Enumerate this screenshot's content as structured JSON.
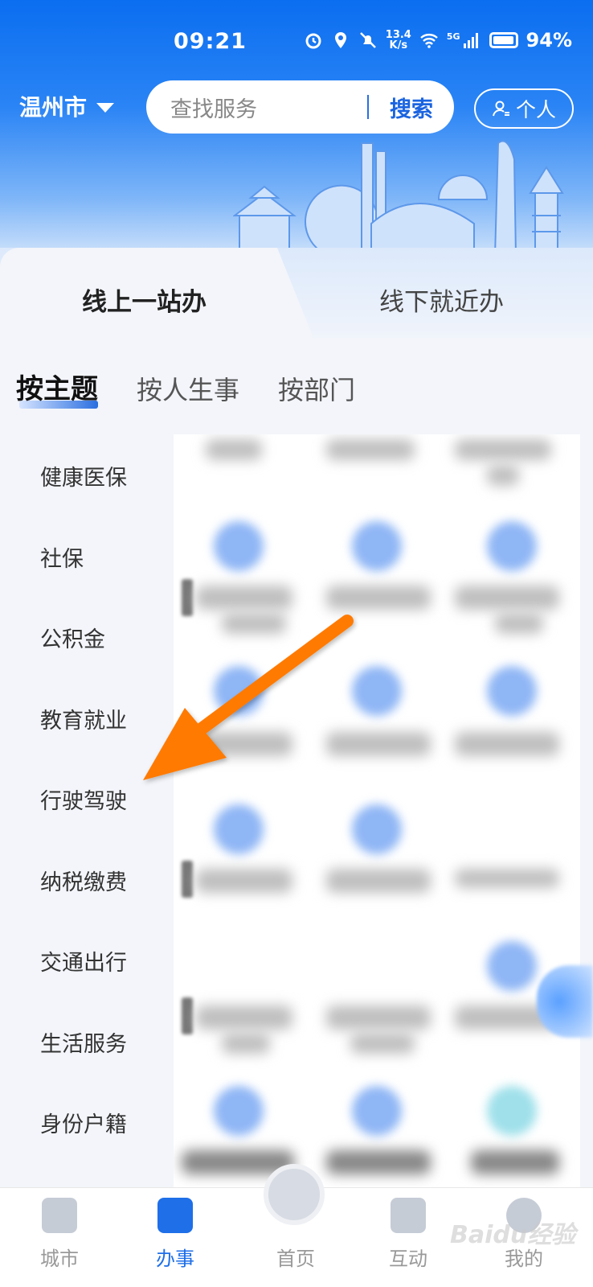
{
  "status_bar": {
    "time": "09:21",
    "net_speed_value": "13.4",
    "net_speed_unit": "K/s",
    "signal_type": "5G",
    "battery": "94%"
  },
  "header": {
    "city": "温州市",
    "search_placeholder": "查找服务",
    "search_button": "搜索",
    "personal_button": "个人"
  },
  "mode_tabs": [
    {
      "label": "线上一站办",
      "active": true
    },
    {
      "label": "线下就近办",
      "active": false
    }
  ],
  "theme_tabs": [
    {
      "label": "按主题",
      "active": true
    },
    {
      "label": "按人生事",
      "active": false
    },
    {
      "label": "按部门",
      "active": false
    }
  ],
  "sidebar": {
    "items": [
      "健康医保",
      "社保",
      "公积金",
      "教育就业",
      "行驶驾驶",
      "纳税缴费",
      "交通出行",
      "生活服务",
      "身份户籍"
    ]
  },
  "bottom_nav": {
    "items": [
      {
        "label": "城市",
        "icon": "city-icon",
        "active": false
      },
      {
        "label": "办事",
        "icon": "clipboard-icon",
        "active": true
      },
      {
        "label": "首页",
        "icon": "home-logo-icon",
        "active": false
      },
      {
        "label": "互动",
        "icon": "chat-icon",
        "active": false
      },
      {
        "label": "我的",
        "icon": "profile-icon",
        "active": false
      }
    ]
  },
  "watermark": "Baidu经验",
  "colors": {
    "accent": "#1e6fe8",
    "header_blue": "#0b6ef0",
    "arrow_orange": "#ff7a00"
  }
}
